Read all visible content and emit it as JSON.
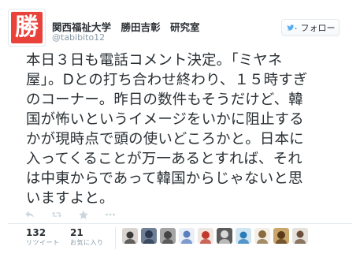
{
  "account": {
    "display_name": "関西福祉大学　勝田吉彰　研究室",
    "handle": "@tabibito12",
    "avatar_glyph": "勝",
    "avatar_color": "#e8423a"
  },
  "follow_button": {
    "label": "フォロー",
    "icon": "follow-bird-plus-icon"
  },
  "tweet": {
    "lines": [
      "本日３日も電話コメント決定。「ミヤネ",
      "屋」。Dとの打ち合わせ終わり、１５時すぎ",
      "のコーナー。昨日の数件もそうだけど、韓",
      "国が怖いというイメージをいかに阻止する",
      "かが現時点で頭の使いどころかと。日本に",
      "入ってくることが万一あるとすれば、それ",
      "は中東からであって韓国からじゃないと思",
      "いますよと。"
    ]
  },
  "actions": [
    {
      "name": "reply-icon"
    },
    {
      "name": "retweet-icon"
    },
    {
      "name": "favorite-star-icon"
    },
    {
      "name": "more-dots-icon"
    }
  ],
  "stats": {
    "retweets": {
      "count": "132",
      "label": "リツイート"
    },
    "favorites": {
      "count": "21",
      "label": "お気に入り"
    }
  },
  "favoriters": [
    {
      "name": "avatar-1",
      "color": "#d9d4cf",
      "accent": "#3a3a3a"
    },
    {
      "name": "avatar-2",
      "color": "#6f7f96",
      "accent": "#2c3a4f"
    },
    {
      "name": "avatar-3",
      "color": "#a4a4a4",
      "accent": "#444444"
    },
    {
      "name": "avatar-4",
      "color": "#e9eef7",
      "accent": "#5a7fc0"
    },
    {
      "name": "avatar-5",
      "color": "#f0e6e0",
      "accent": "#c0392b"
    },
    {
      "name": "avatar-6",
      "color": "#5b5b5b",
      "accent": "#d8d8d8"
    },
    {
      "name": "avatar-7",
      "color": "#cfe6f2",
      "accent": "#2b7bb9"
    },
    {
      "name": "avatar-8",
      "color": "#f3efe7",
      "accent": "#8b6b3d"
    },
    {
      "name": "avatar-9",
      "color": "#c9a66b",
      "accent": "#5a3a1a"
    },
    {
      "name": "avatar-10",
      "color": "#e6e1da",
      "accent": "#6b4f3a"
    }
  ]
}
